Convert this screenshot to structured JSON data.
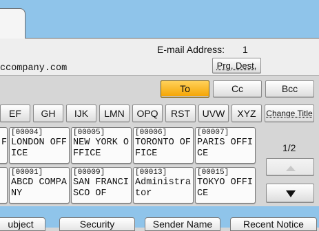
{
  "header": {
    "email_label": "E-mail Address:",
    "email_count": "1",
    "address_value": "ccompany.com",
    "prg_dest_label": "Prg. Dest."
  },
  "recipient_buttons": {
    "to": "To",
    "cc": "Cc",
    "bcc": "Bcc"
  },
  "index_tabs": [
    "EF",
    "GH",
    "IJK",
    "LMN",
    "OPQ",
    "RST",
    "UVW",
    "XYZ"
  ],
  "change_title_label": "Change Title",
  "entries": [
    {
      "num": "[00004]",
      "line1": "LONDON OFF",
      "line2": "ICE"
    },
    {
      "num": "[00005]",
      "line1": "NEW YORK O",
      "line2": "FFICE"
    },
    {
      "num": "[00006]",
      "line1": "TORONTO OF",
      "line2": "FICE"
    },
    {
      "num": "[00007]",
      "line1": "PARIS OFFI",
      "line2": "CE"
    },
    {
      "num": "[00001]",
      "line1": "ABCD COMPA",
      "line2": "NY"
    },
    {
      "num": "[00009]",
      "line1": "SAN FRANCI",
      "line2": "SCO OF"
    },
    {
      "num": "[00013]",
      "line1": "Administra",
      "line2": "tor"
    },
    {
      "num": "[00015]",
      "line1": "TOKYO OFFI",
      "line2": "CE"
    }
  ],
  "left_stubs": [
    "F",
    ""
  ],
  "page_indicator": "1/2",
  "bottom_tabs": [
    "ubject",
    "Security",
    "Sender Name",
    "Recent Notice"
  ],
  "icons": {
    "scroll_up": "up-arrow-icon",
    "scroll_down": "down-arrow-icon"
  },
  "colors": {
    "accent_active": "#f4a300",
    "bars": "#8fc4ea"
  }
}
